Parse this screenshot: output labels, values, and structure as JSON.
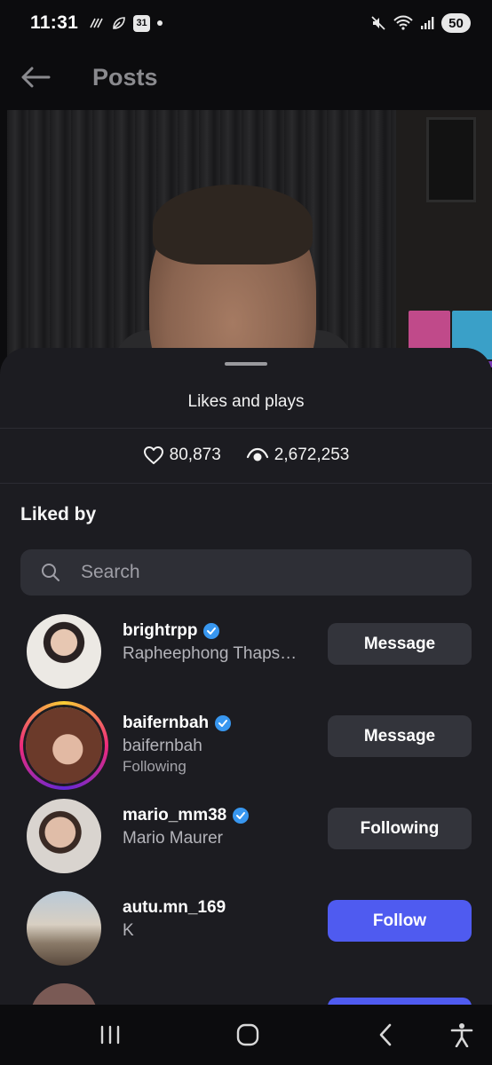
{
  "status_bar": {
    "time": "11:31",
    "calendar_day": "31",
    "battery": "50"
  },
  "header": {
    "title": "Posts"
  },
  "sheet": {
    "title": "Likes and plays",
    "likes": "80,873",
    "plays": "2,672,253",
    "section_title": "Liked by",
    "search_placeholder": "Search"
  },
  "users": [
    {
      "username": "brightrpp",
      "full_name": "Rapheephong Thaps…",
      "sub": "",
      "verified": true,
      "button": "Message"
    },
    {
      "username": "baifernbah",
      "full_name": "baifernbah",
      "sub": "Following",
      "verified": true,
      "button": "Message"
    },
    {
      "username": "mario_mm38",
      "full_name": "Mario Maurer",
      "sub": "",
      "verified": true,
      "button": "Following"
    },
    {
      "username": "autu.mn_169",
      "full_name": "K",
      "sub": "",
      "verified": false,
      "button": "Follow"
    }
  ],
  "colors": {
    "background": "#0c0c0e",
    "sheet": "#1c1c21",
    "secondary_button": "#33343b",
    "primary_button": "#4f5bf0",
    "verified_badge": "#3897f0"
  },
  "icons": {
    "back": "arrow-left-icon",
    "likes": "heart-icon",
    "plays": "eye-play-icon",
    "search": "search-icon",
    "verified": "verified-badge-icon",
    "nav_recents": "recents-icon",
    "nav_home": "home-icon",
    "nav_back": "back-icon",
    "nav_accessibility": "accessibility-icon"
  }
}
